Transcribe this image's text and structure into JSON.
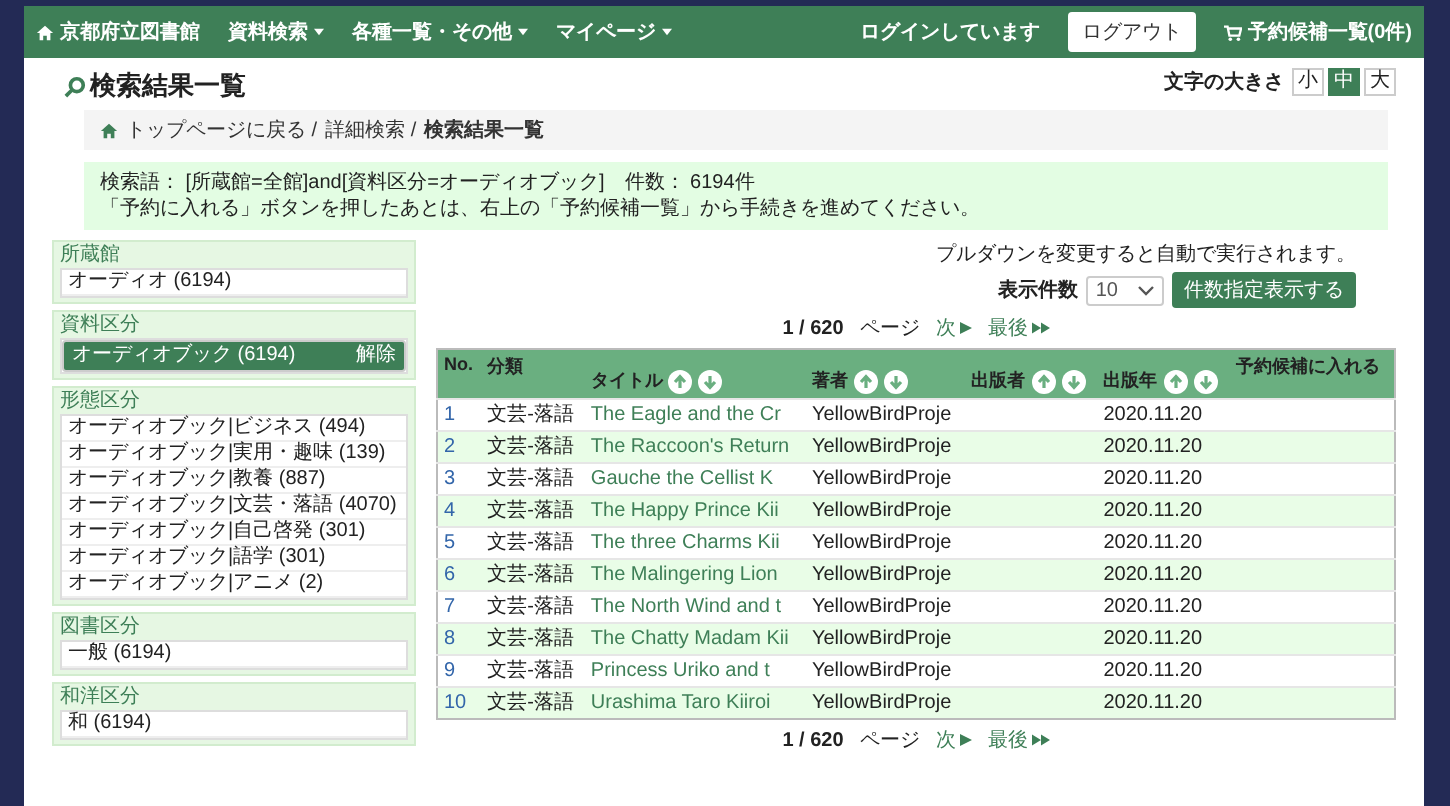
{
  "nav": {
    "brand": "京都府立図書館",
    "menus": [
      "資料検索",
      "各種一覧・その他",
      "マイページ"
    ],
    "login_status": "ログインしています",
    "logout_button": "ログアウト",
    "cart": "予約候補一覧(0件)"
  },
  "page": {
    "title": "検索結果一覧",
    "font_size": {
      "label": "文字の大きさ",
      "options": [
        {
          "label": "小",
          "selected": false
        },
        {
          "label": "中",
          "selected": true
        },
        {
          "label": "大",
          "selected": false
        }
      ]
    }
  },
  "breadcrumb": [
    "トップページに戻る /",
    "詳細検索 /",
    "検索結果一覧"
  ],
  "info": {
    "query": "検索語： [所蔵館=全館]and[資料区分=オーディオブック]　件数： 6194件",
    "note": "「予約に入れる」ボタンを押したあとは、右上の「予約候補一覧」から手続きを進めてください。"
  },
  "facets": [
    {
      "title": "所蔵館",
      "items": [
        {
          "label": "オーディオ (6194)",
          "selected": false
        }
      ]
    },
    {
      "title": "資料区分",
      "items": [
        {
          "label": "オーディオブック (6194)",
          "selected": true,
          "clear": "解除"
        }
      ]
    },
    {
      "title": "形態区分",
      "items": [
        {
          "label": "オーディオブック|ビジネス (494)",
          "selected": false
        },
        {
          "label": "オーディオブック|実用・趣味 (139)",
          "selected": false
        },
        {
          "label": "オーディオブック|教養 (887)",
          "selected": false
        },
        {
          "label": "オーディオブック|文芸・落語 (4070)",
          "selected": false
        },
        {
          "label": "オーディオブック|自己啓発 (301)",
          "selected": false
        },
        {
          "label": "オーディオブック|語学 (301)",
          "selected": false
        },
        {
          "label": "オーディオブック|アニメ (2)",
          "selected": false
        }
      ]
    },
    {
      "title": "図書区分",
      "items": [
        {
          "label": "一般 (6194)",
          "selected": false
        }
      ]
    },
    {
      "title": "和洋区分",
      "items": [
        {
          "label": "和 (6194)",
          "selected": false
        }
      ]
    }
  ],
  "controls": {
    "hint": "プルダウンを変更すると自動で実行されます。",
    "per_page_label": "表示件数",
    "per_page_value": "10",
    "apply_button": "件数指定表示する"
  },
  "pagers": [
    {
      "position": "1 / 620",
      "unit": "ページ",
      "next": "次",
      "last": "最後"
    },
    {
      "position": "1 / 620",
      "unit": "ページ",
      "next": "次",
      "last": "最後"
    }
  ],
  "table": {
    "columns": [
      {
        "label": "No.",
        "sortable": false
      },
      {
        "label": "分類",
        "sortable": false
      },
      {
        "label": "タイトル",
        "sortable": true
      },
      {
        "label": "著者",
        "sortable": true
      },
      {
        "label": "出版者",
        "sortable": true
      },
      {
        "label": "出版年",
        "sortable": true
      },
      {
        "label": "予約候補に入れる",
        "sortable": false
      }
    ],
    "rows": [
      {
        "no": "1",
        "category": "文芸-落語",
        "title": "The Eagle and the Cr",
        "author": "YellowBirdProje",
        "year": "2020.11.20"
      },
      {
        "no": "2",
        "category": "文芸-落語",
        "title": "The Raccoon's Return",
        "author": "YellowBirdProje",
        "year": "2020.11.20"
      },
      {
        "no": "3",
        "category": "文芸-落語",
        "title": "Gauche the Cellist  K",
        "author": "YellowBirdProje",
        "year": "2020.11.20"
      },
      {
        "no": "4",
        "category": "文芸-落語",
        "title": "The Happy Prince  Kii",
        "author": "YellowBirdProje",
        "year": "2020.11.20"
      },
      {
        "no": "5",
        "category": "文芸-落語",
        "title": "The three Charms  Kii",
        "author": "YellowBirdProje",
        "year": "2020.11.20"
      },
      {
        "no": "6",
        "category": "文芸-落語",
        "title": "The Malingering Lion",
        "author": "YellowBirdProje",
        "year": "2020.11.20"
      },
      {
        "no": "7",
        "category": "文芸-落語",
        "title": "The North Wind and t",
        "author": "YellowBirdProje",
        "year": "2020.11.20"
      },
      {
        "no": "8",
        "category": "文芸-落語",
        "title": "The Chatty Madam  Kii",
        "author": "YellowBirdProje",
        "year": "2020.11.20"
      },
      {
        "no": "9",
        "category": "文芸-落語",
        "title": "Princess Uriko and t",
        "author": "YellowBirdProje",
        "year": "2020.11.20"
      },
      {
        "no": "10",
        "category": "文芸-落語",
        "title": "Urashima Taro  Kiiroi",
        "author": "YellowBirdProje",
        "year": "2020.11.20"
      }
    ]
  }
}
